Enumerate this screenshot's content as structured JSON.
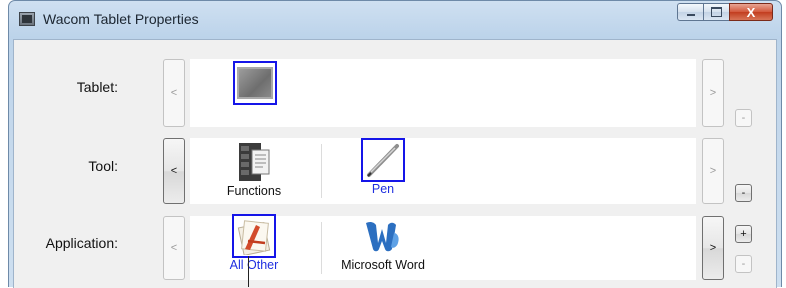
{
  "window": {
    "title": "Wacom Tablet Properties",
    "close_glyph": "X"
  },
  "rows": {
    "tablet": {
      "label": "Tablet:",
      "prev": "<",
      "next": ">",
      "remove": "-"
    },
    "tool": {
      "label": "Tool:",
      "prev": "<",
      "next": ">",
      "remove": "-",
      "items": [
        {
          "label": "Functions",
          "icon": "functions-icon",
          "selected": false
        },
        {
          "label": "Pen",
          "icon": "pen-icon",
          "selected": true
        }
      ]
    },
    "application": {
      "label": "Application:",
      "prev": "<",
      "next": ">",
      "add": "+",
      "remove": "-",
      "items": [
        {
          "label": "All Other",
          "icon": "all-other-icon",
          "selected": true
        },
        {
          "label": "Microsoft Word",
          "icon": "microsoft-word-icon",
          "selected": false
        }
      ]
    }
  },
  "colors": {
    "selection": "#1515e8",
    "selected_text": "#1f2fe0"
  }
}
